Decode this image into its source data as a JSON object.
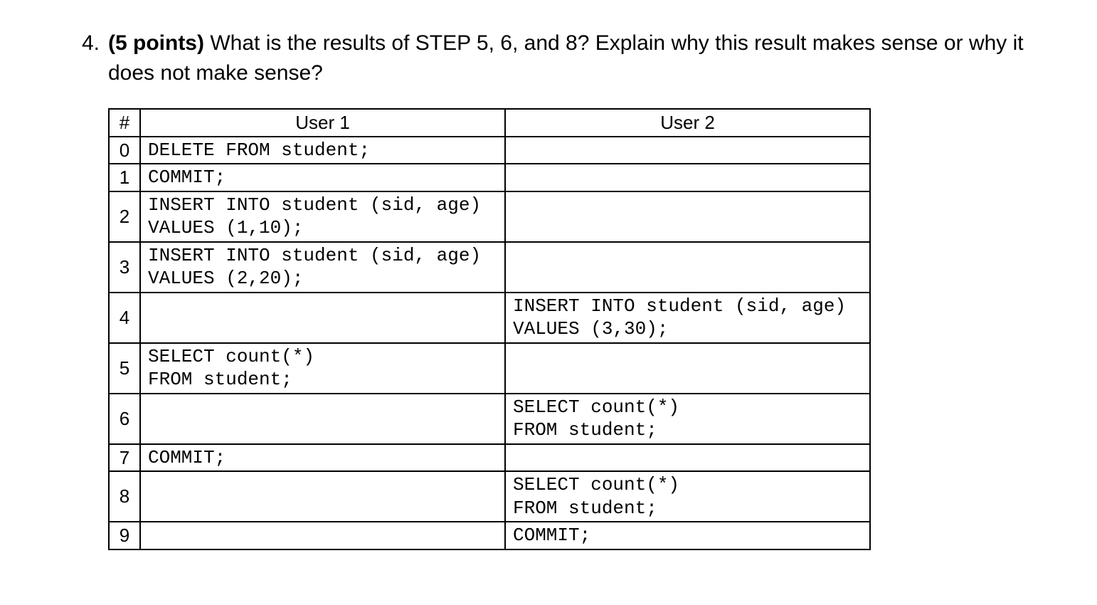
{
  "question": {
    "number": "4.",
    "points_label": "(5 points)",
    "text_part1": " What is the results of STEP 5, 6, and 8? Explain why this result makes sense or why it does not make sense?"
  },
  "table": {
    "headers": {
      "col_num": "#",
      "user1": "User 1",
      "user2": "User 2"
    },
    "rows": [
      {
        "n": "0",
        "u1": "DELETE FROM student;",
        "u2": ""
      },
      {
        "n": "1",
        "u1": "COMMIT;",
        "u2": ""
      },
      {
        "n": "2",
        "u1": "INSERT INTO student (sid, age)\nVALUES (1,10);",
        "u2": ""
      },
      {
        "n": "3",
        "u1": "INSERT INTO student (sid, age)\nVALUES (2,20);",
        "u2": ""
      },
      {
        "n": "4",
        "u1": "",
        "u2": "INSERT INTO student (sid, age)\nVALUES (3,30);"
      },
      {
        "n": "5",
        "u1": "SELECT count(*)\nFROM student;",
        "u2": ""
      },
      {
        "n": "6",
        "u1": "",
        "u2": "SELECT count(*)\nFROM student;"
      },
      {
        "n": "7",
        "u1": "COMMIT;",
        "u2": ""
      },
      {
        "n": "8",
        "u1": "",
        "u2": "SELECT count(*)\nFROM student;"
      },
      {
        "n": "9",
        "u1": "",
        "u2": "COMMIT;"
      }
    ]
  }
}
